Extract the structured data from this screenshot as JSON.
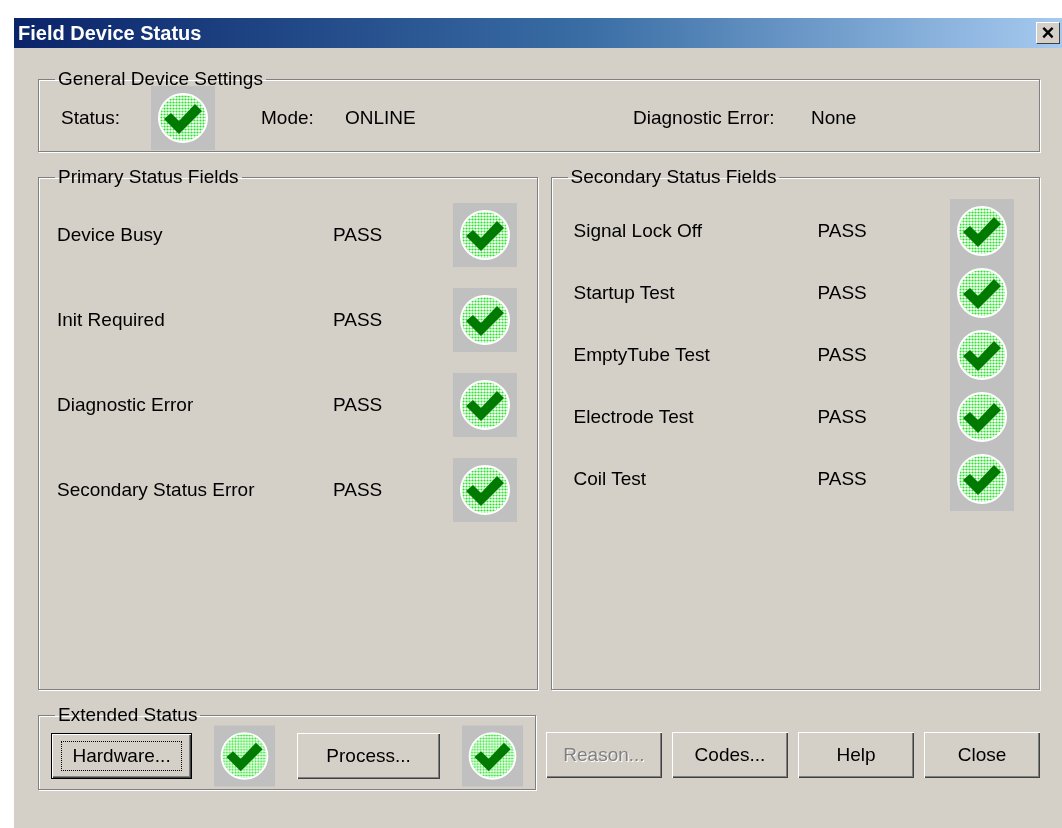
{
  "window": {
    "title": "Field Device Status",
    "close_label": "×"
  },
  "general": {
    "title": "General Device Settings",
    "status_label": "Status:",
    "ok": true,
    "mode_label": "Mode:",
    "mode": "ONLINE",
    "diag_label": "Diagnostic Error:",
    "diag": "None"
  },
  "primary": {
    "title": "Primary Status Fields",
    "rows": [
      {
        "name": "Device Busy",
        "result": "PASS",
        "ok": true
      },
      {
        "name": "Init Required",
        "result": "PASS",
        "ok": true
      },
      {
        "name": "Diagnostic Error",
        "result": "PASS",
        "ok": true
      },
      {
        "name": "Secondary Status Error",
        "result": "PASS",
        "ok": true
      }
    ]
  },
  "secondary": {
    "title": "Secondary Status Fields",
    "rows": [
      {
        "name": "Signal Lock Off",
        "result": "PASS",
        "ok": true
      },
      {
        "name": "Startup Test",
        "result": "PASS",
        "ok": true
      },
      {
        "name": "EmptyTube Test",
        "result": "PASS",
        "ok": true
      },
      {
        "name": "Electrode Test",
        "result": "PASS",
        "ok": true
      },
      {
        "name": "Coil Test",
        "result": "PASS",
        "ok": true
      }
    ]
  },
  "extended": {
    "title": "Extended Status",
    "items": [
      {
        "label": "Hardware...",
        "focused": true,
        "ok": true
      },
      {
        "label": "Process...",
        "focused": false,
        "ok": true
      }
    ]
  },
  "buttons": [
    {
      "label": "Reason...",
      "disabled": true
    },
    {
      "label": "Codes...",
      "disabled": false
    },
    {
      "label": "Help",
      "disabled": false
    },
    {
      "label": "Close",
      "disabled": false
    }
  ]
}
